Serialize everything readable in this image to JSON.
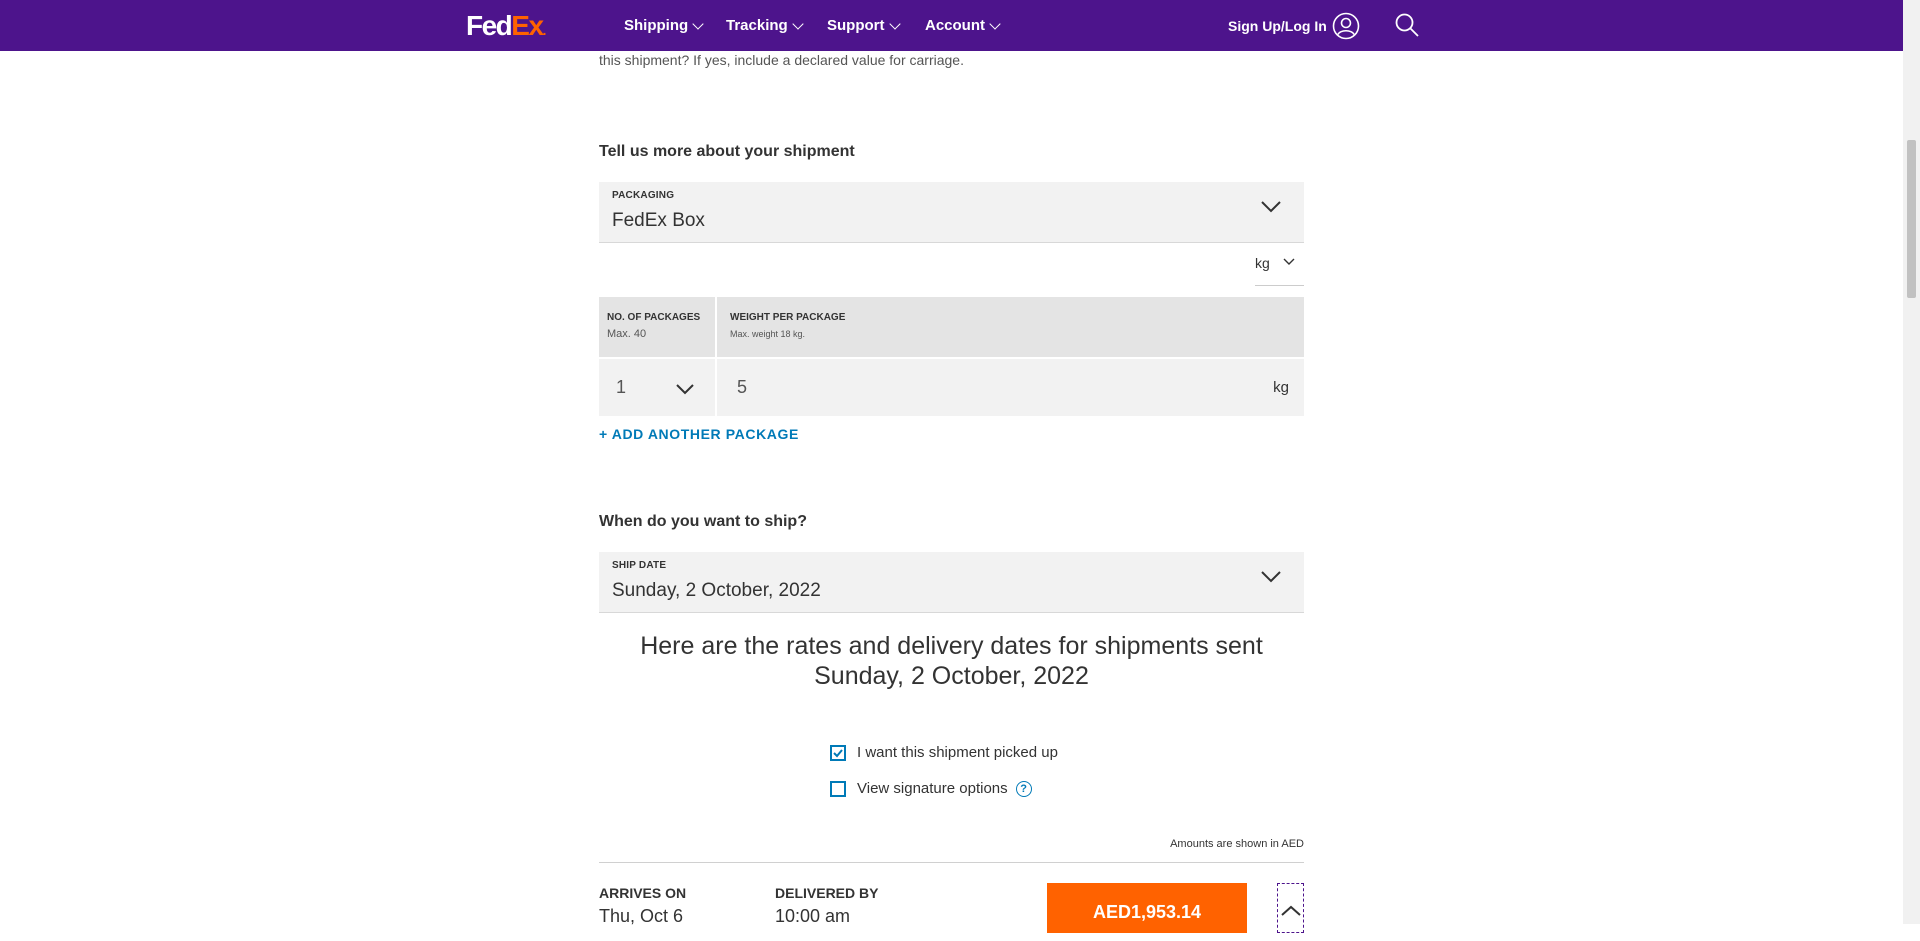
{
  "header": {
    "logo_fed": "Fed",
    "logo_ex": "Ex",
    "logo_dot": ".",
    "nav": [
      {
        "label": "Shipping"
      },
      {
        "label": "Tracking"
      },
      {
        "label": "Support"
      },
      {
        "label": "Account"
      }
    ],
    "signin_label": "Sign Up/Log In",
    "brand_color": "#4d148c",
    "accent_color": "#ff6200"
  },
  "intro_text": "this shipment? If yes, include a declared value for carriage.",
  "shipment": {
    "title": "Tell us more about your shipment",
    "packaging_label": "PACKAGING",
    "packaging_value": "FedEx Box",
    "unit_value": "kg",
    "packages_head": "NO. OF PACKAGES",
    "packages_sub": "Max. 40",
    "weight_head": "WEIGHT PER PACKAGE",
    "weight_sub": "Max. weight 18 kg.",
    "packages_value": "1",
    "weight_value": "5",
    "weight_unit": "kg",
    "add_package": "+ ADD ANOTHER PACKAGE"
  },
  "ship": {
    "title": "When do you want to ship?",
    "date_label": "SHIP DATE",
    "date_value": "Sunday, 2 October, 2022"
  },
  "rates": {
    "heading_line1": "Here are the rates and delivery dates for shipments sent",
    "heading_line2": "Sunday, 2 October, 2022",
    "pickup_label": "I want this shipment picked up",
    "pickup_checked": true,
    "signature_label": "View signature options",
    "signature_checked": false,
    "help_glyph": "?",
    "amounts_note": "Amounts are shown in AED"
  },
  "result": {
    "arrives_label": "ARRIVES ON",
    "arrives_value": "Thu, Oct 6",
    "delivered_label": "DELIVERED BY",
    "delivered_value": "10:00 am",
    "price": "AED1,953.14"
  }
}
